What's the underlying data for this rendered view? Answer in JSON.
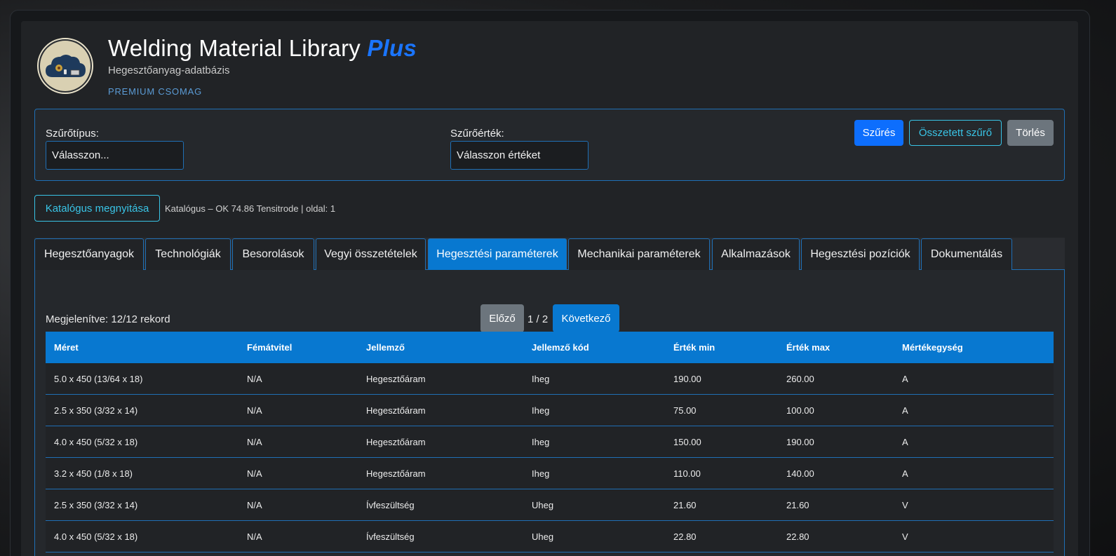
{
  "header": {
    "title_main": "Welding Material Library",
    "title_accent": "Plus",
    "subtitle": "Hegesztőanyag-adatbázis",
    "package": "PREMIUM CSOMAG"
  },
  "filters": {
    "type_label": "Szűrőtípus:",
    "type_value": "Válasszon...",
    "value_label": "Szűrőérték:",
    "value_value": "Válasszon értéket",
    "filter_button": "Szűrés",
    "compound_button": "Összetett szűrő",
    "clear_button": "Törlés"
  },
  "catalog": {
    "open_button": "Katalógus megnyitása",
    "info": "Katalógus – OK 74.86 Tensitrode | oldal: 1"
  },
  "tabs": [
    {
      "label": "Hegesztőanyagok",
      "active": false
    },
    {
      "label": "Technológiák",
      "active": false
    },
    {
      "label": "Besorolások",
      "active": false
    },
    {
      "label": "Vegyi összetételek",
      "active": false
    },
    {
      "label": "Hegesztési paraméterek",
      "active": true
    },
    {
      "label": "Mechanikai paraméterek",
      "active": false
    },
    {
      "label": "Alkalmazások",
      "active": false
    },
    {
      "label": "Hegesztési pozíciók",
      "active": false
    },
    {
      "label": "Dokumentálás",
      "active": false
    }
  ],
  "pager": {
    "record_count": "Megjelenítve: 12/12 rekord",
    "prev": "Előző",
    "page": "1 / 2",
    "next": "Következő"
  },
  "table": {
    "columns": [
      "Méret",
      "Fémátvitel",
      "Jellemző",
      "Jellemző kód",
      "Érték min",
      "Érték max",
      "Mértékegység"
    ],
    "rows": [
      [
        "5.0 x 450 (13/64 x 18)",
        "N/A",
        "Hegesztőáram",
        "Iheg",
        "190.00",
        "260.00",
        "A"
      ],
      [
        "2.5 x 350 (3/32 x 14)",
        "N/A",
        "Hegesztőáram",
        "Iheg",
        "75.00",
        "100.00",
        "A"
      ],
      [
        "4.0 x 450 (5/32 x 18)",
        "N/A",
        "Hegesztőáram",
        "Iheg",
        "150.00",
        "190.00",
        "A"
      ],
      [
        "3.2 x 450 (1/8 x 18)",
        "N/A",
        "Hegesztőáram",
        "Iheg",
        "110.00",
        "140.00",
        "A"
      ],
      [
        "2.5 x 350 (3/32 x 14)",
        "N/A",
        "Ívfeszültség",
        "Uheg",
        "21.60",
        "21.60",
        "V"
      ],
      [
        "4.0 x 450 (5/32 x 18)",
        "N/A",
        "Ívfeszültség",
        "Uheg",
        "22.80",
        "22.80",
        "V"
      ]
    ]
  },
  "colors": {
    "accent": "#0878d0",
    "brand_plus": "#1a75ff",
    "outline_cyan": "#39c4e6",
    "border_blue": "#1f6fb5"
  }
}
